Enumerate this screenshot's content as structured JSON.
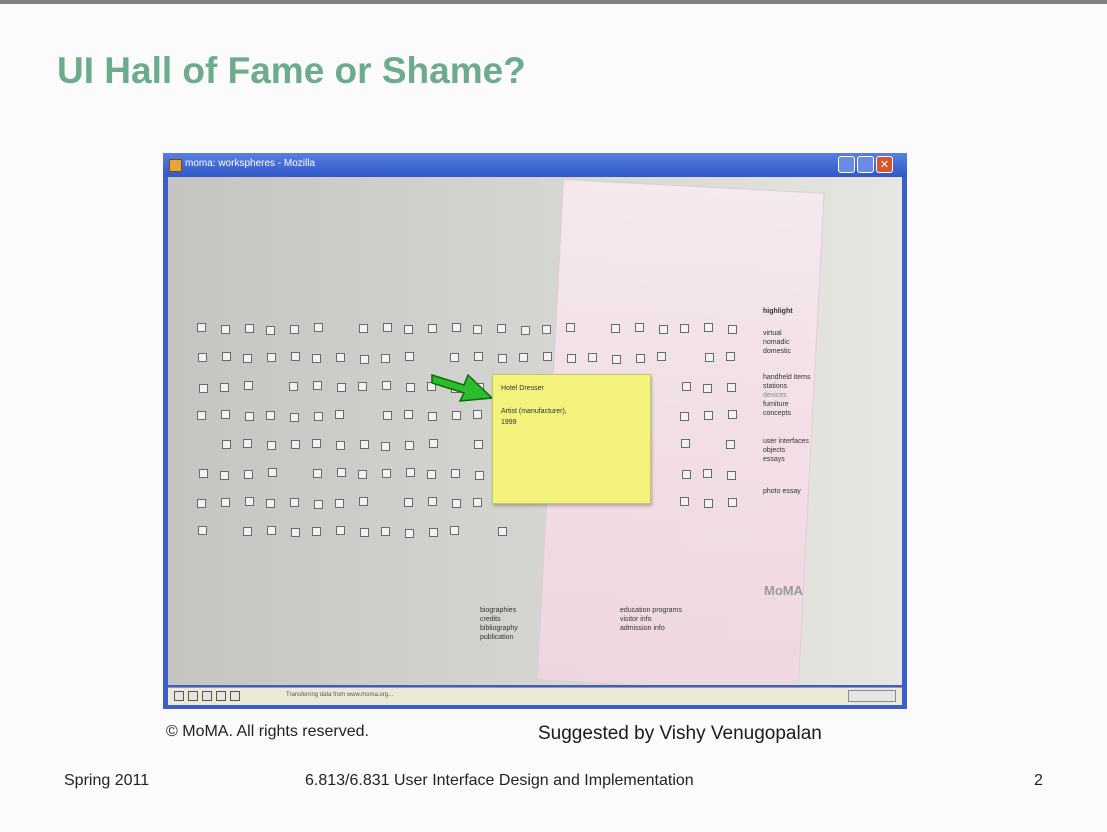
{
  "slide": {
    "title": "UI Hall of Fame or Shame?",
    "copyright": "© MoMA. All rights reserved.",
    "suggested_by": "Suggested by Vishy Venugopalan",
    "footer": {
      "left": "Spring 2011",
      "center": "6.813/6.831 User Interface Design and Implementation",
      "page": "2"
    }
  },
  "browser": {
    "window_title": "moma: workspheres - Mozilla",
    "close_glyph": "✕",
    "status_text": "Transferring data from www.moma.org...",
    "note": {
      "title": "Hotel Dresser",
      "line1": "Artist (manufacturer),",
      "line2": "1999"
    },
    "right_labels": {
      "highlight": "highlight",
      "virtual": "virtual",
      "nomadic": "nomadic",
      "domestic": "domestic",
      "handheld": "handheld items",
      "stations": "stations",
      "devices": "devices",
      "furniture": "furniture",
      "concepts": "concepts",
      "user_interfaces": "user interfaces",
      "objects": "objects",
      "essays": "essays",
      "photo_essay": "photo essay"
    },
    "logo": "MoMA",
    "bottom_links": {
      "biographies": "biographies",
      "credits": "credits",
      "bibliography": "bibliography",
      "publication": "publication",
      "education": "education programs",
      "visitor": "visitor info",
      "admission": "admission info"
    }
  },
  "icons": [
    "app-icon",
    "green-arrow-icon",
    "minimize-icon",
    "maximize-icon",
    "close-icon"
  ],
  "colors": {
    "title": "#6cab8c",
    "window_frame": "#3d5ec9",
    "note": "#f2f27d",
    "card_pink": "#f4dfe6",
    "arrow": "#2bbd2b"
  }
}
